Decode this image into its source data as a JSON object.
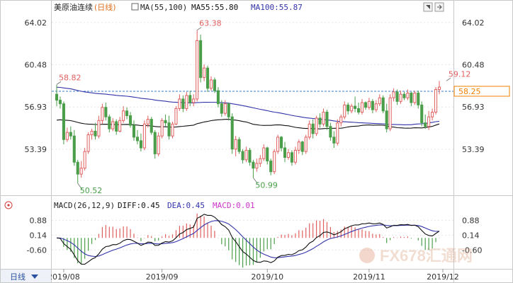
{
  "header": {
    "instrument": "美原油连续",
    "period": "(日线)",
    "ma_text": "MA(55,100)",
    "ma55_text": "MA55:55.80",
    "ma100_text": "MA100:55.87"
  },
  "macd_header": {
    "params": "MACD(26,12,9)",
    "diff_text": "DIFF:0.45",
    "dea_text": "DEA:0.45",
    "macd_text": "MACD:0.01"
  },
  "period_badge": "日线",
  "watermark": "FX678汇通网",
  "colors": {
    "up": "#e06060",
    "down": "#4a9e4a",
    "ma55": "#111111",
    "ma100": "#3333aa",
    "dea": "#3333aa",
    "ref_line": "#3a7cc8",
    "current_tag": "#f08000"
  },
  "chart_data": [
    {
      "type": "candlestick",
      "title": "美原油连续(日线)",
      "y_ticks": [
        "64.02",
        "60.48",
        "56.93",
        "53.39"
      ],
      "ylim": [
        50.0,
        64.6
      ],
      "x_ticks": [
        "2019/08",
        "2019/09",
        "2019/10",
        "2019/11",
        "2019/12"
      ],
      "reference_line": 58.25,
      "current_price_label": "58.25",
      "annotations": [
        {
          "text": "58.82",
          "value": 58.82,
          "index": 0
        },
        {
          "text": "63.38",
          "value": 63.38,
          "index": 40
        },
        {
          "text": "50.52",
          "value": 50.52,
          "index": 6
        },
        {
          "text": "50.99",
          "value": 50.99,
          "index": 56
        },
        {
          "text": "59.12",
          "value": 59.12,
          "index": 111
        }
      ],
      "ohlc": [
        [
          58.0,
          58.8,
          57.0,
          57.5
        ],
        [
          57.5,
          57.8,
          56.8,
          57.2
        ],
        [
          57.2,
          57.4,
          53.8,
          54.2
        ],
        [
          54.2,
          55.2,
          54.0,
          54.8
        ],
        [
          54.8,
          55.3,
          54.2,
          54.5
        ],
        [
          54.5,
          55.0,
          52.0,
          52.3
        ],
        [
          52.3,
          52.5,
          50.52,
          51.3
        ],
        [
          51.3,
          52.4,
          51.0,
          51.8
        ],
        [
          51.8,
          53.5,
          51.6,
          53.2
        ],
        [
          53.2,
          54.8,
          53.0,
          54.6
        ],
        [
          54.6,
          55.1,
          54.2,
          54.9
        ],
        [
          54.9,
          55.6,
          54.2,
          54.5
        ],
        [
          54.5,
          56.2,
          54.3,
          55.8
        ],
        [
          55.8,
          57.2,
          55.5,
          56.9
        ],
        [
          56.9,
          57.3,
          55.8,
          56.1
        ],
        [
          56.1,
          56.3,
          54.8,
          55.1
        ],
        [
          55.1,
          56.0,
          54.9,
          55.7
        ],
        [
          55.7,
          55.9,
          54.6,
          54.9
        ],
        [
          54.9,
          56.1,
          54.8,
          55.8
        ],
        [
          55.8,
          57.0,
          55.6,
          56.6
        ],
        [
          56.6,
          56.9,
          55.9,
          56.2
        ],
        [
          56.2,
          56.5,
          55.2,
          55.4
        ],
        [
          55.4,
          55.8,
          54.1,
          54.4
        ],
        [
          54.4,
          55.0,
          53.8,
          54.1
        ],
        [
          54.1,
          54.7,
          53.2,
          53.5
        ],
        [
          53.5,
          55.8,
          53.3,
          55.5
        ],
        [
          55.5,
          56.2,
          55.2,
          55.9
        ],
        [
          55.9,
          56.1,
          54.6,
          54.8
        ],
        [
          54.8,
          55.0,
          52.6,
          53.0
        ],
        [
          53.0,
          54.8,
          52.8,
          54.5
        ],
        [
          54.5,
          56.0,
          54.3,
          55.8
        ],
        [
          55.8,
          56.3,
          55.3,
          55.6
        ],
        [
          55.6,
          56.2,
          54.2,
          54.5
        ],
        [
          54.5,
          55.7,
          54.3,
          55.5
        ],
        [
          55.5,
          57.0,
          55.4,
          56.8
        ],
        [
          56.8,
          58.0,
          56.6,
          57.6
        ],
        [
          57.6,
          57.9,
          56.5,
          56.8
        ],
        [
          56.8,
          58.2,
          56.6,
          57.9
        ],
        [
          57.9,
          58.3,
          57.0,
          57.3
        ],
        [
          57.3,
          58.0,
          57.0,
          57.6
        ],
        [
          57.6,
          63.38,
          57.4,
          62.5
        ],
        [
          62.5,
          63.0,
          59.0,
          59.4
        ],
        [
          59.4,
          60.5,
          59.1,
          60.2
        ],
        [
          60.2,
          60.4,
          58.2,
          58.5
        ],
        [
          58.5,
          59.5,
          58.3,
          59.2
        ],
        [
          59.2,
          59.4,
          58.1,
          58.3
        ],
        [
          58.3,
          58.6,
          56.9,
          57.2
        ],
        [
          57.2,
          57.5,
          56.1,
          56.4
        ],
        [
          56.4,
          57.5,
          56.2,
          57.2
        ],
        [
          57.2,
          57.3,
          55.8,
          56.1
        ],
        [
          56.1,
          56.4,
          53.0,
          53.4
        ],
        [
          53.4,
          54.5,
          52.8,
          54.2
        ],
        [
          54.2,
          54.4,
          53.0,
          53.2
        ],
        [
          53.2,
          53.4,
          52.2,
          52.5
        ],
        [
          52.5,
          53.6,
          52.3,
          53.3
        ],
        [
          53.3,
          53.5,
          52.0,
          52.3
        ],
        [
          52.3,
          52.5,
          50.99,
          51.8
        ],
        [
          51.8,
          52.6,
          51.5,
          52.2
        ],
        [
          52.2,
          52.9,
          51.9,
          52.6
        ],
        [
          52.6,
          53.8,
          52.4,
          53.5
        ],
        [
          53.5,
          53.6,
          52.1,
          52.4
        ],
        [
          52.4,
          52.6,
          51.2,
          51.5
        ],
        [
          51.5,
          53.4,
          51.3,
          53.2
        ],
        [
          53.2,
          54.6,
          53.0,
          54.4
        ],
        [
          54.4,
          54.5,
          53.2,
          53.5
        ],
        [
          53.5,
          54.0,
          52.3,
          52.7
        ],
        [
          52.7,
          53.4,
          52.5,
          53.1
        ],
        [
          53.1,
          53.3,
          52.0,
          52.3
        ],
        [
          52.3,
          53.6,
          52.1,
          53.3
        ],
        [
          53.3,
          54.2,
          53.0,
          54.0
        ],
        [
          54.0,
          54.1,
          52.9,
          53.2
        ],
        [
          53.2,
          54.6,
          53.0,
          54.4
        ],
        [
          54.4,
          55.8,
          54.2,
          55.5
        ],
        [
          55.5,
          55.9,
          54.3,
          54.7
        ],
        [
          54.7,
          56.2,
          54.5,
          56.0
        ],
        [
          56.0,
          56.4,
          55.2,
          55.5
        ],
        [
          55.5,
          56.8,
          55.3,
          56.5
        ],
        [
          56.5,
          56.7,
          55.0,
          55.3
        ],
        [
          55.3,
          55.6,
          54.1,
          54.4
        ],
        [
          54.4,
          54.9,
          53.5,
          53.9
        ],
        [
          53.9,
          55.9,
          53.7,
          55.6
        ],
        [
          55.6,
          56.3,
          55.3,
          56.1
        ],
        [
          56.1,
          57.4,
          55.9,
          57.1
        ],
        [
          57.1,
          57.3,
          56.3,
          56.6
        ],
        [
          56.6,
          57.2,
          56.4,
          57.0
        ],
        [
          57.0,
          57.8,
          56.5,
          56.8
        ],
        [
          56.8,
          57.3,
          56.3,
          56.5
        ],
        [
          56.5,
          57.6,
          56.3,
          57.3
        ],
        [
          57.3,
          57.4,
          56.7,
          56.9
        ],
        [
          56.9,
          57.7,
          56.7,
          57.4
        ],
        [
          57.4,
          57.6,
          56.4,
          56.7
        ],
        [
          56.7,
          57.5,
          56.5,
          57.2
        ],
        [
          57.2,
          58.0,
          57.0,
          57.7
        ],
        [
          57.7,
          57.9,
          56.4,
          56.6
        ],
        [
          56.6,
          57.2,
          54.8,
          55.1
        ],
        [
          55.1,
          58.0,
          54.9,
          57.7
        ],
        [
          57.7,
          58.5,
          57.4,
          58.2
        ],
        [
          58.2,
          58.4,
          57.1,
          57.4
        ],
        [
          57.4,
          58.3,
          57.2,
          58.0
        ],
        [
          58.0,
          58.2,
          57.5,
          57.7
        ],
        [
          57.7,
          58.4,
          57.5,
          58.1
        ],
        [
          58.1,
          58.2,
          57.0,
          57.3
        ],
        [
          57.3,
          58.3,
          57.1,
          58.1
        ],
        [
          58.1,
          58.3,
          56.8,
          57.1
        ],
        [
          57.1,
          57.4,
          55.3,
          55.6
        ],
        [
          55.6,
          56.3,
          55.1,
          55.3
        ],
        [
          55.3,
          56.6,
          55.0,
          56.1
        ],
        [
          56.1,
          56.8,
          55.8,
          56.5
        ],
        [
          56.5,
          58.6,
          56.3,
          58.4
        ],
        [
          58.4,
          59.12,
          58.0,
          58.6
        ]
      ]
    },
    {
      "type": "line",
      "title": "MACD(26,12,9)",
      "y_ticks": [
        "0.88",
        "0.14",
        "-0.60"
      ],
      "ylim": [
        -1.4,
        1.35
      ],
      "series": [
        {
          "name": "DIFF",
          "value": 0.45
        },
        {
          "name": "DEA",
          "value": 0.45
        },
        {
          "name": "MACD",
          "value": 0.01
        }
      ]
    }
  ]
}
